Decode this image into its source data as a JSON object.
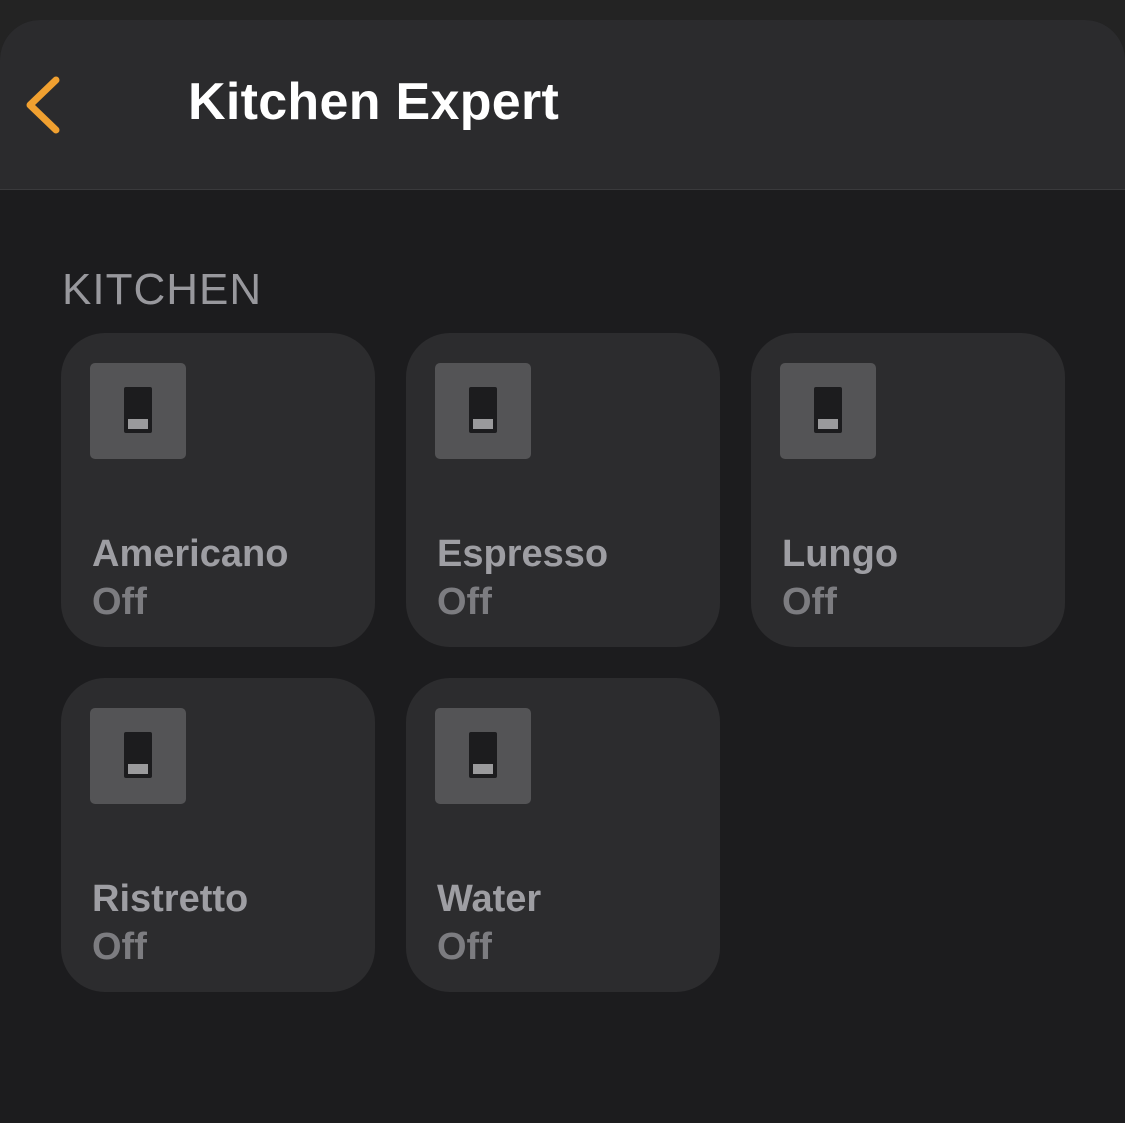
{
  "header": {
    "title": "Kitchen Expert",
    "back_icon": "chevron-left-icon",
    "accent_color": "#f0a030"
  },
  "section": {
    "label": "KITCHEN"
  },
  "tiles": [
    {
      "name": "Americano",
      "state": "Off",
      "icon": "switch-icon"
    },
    {
      "name": "Espresso",
      "state": "Off",
      "icon": "switch-icon"
    },
    {
      "name": "Lungo",
      "state": "Off",
      "icon": "switch-icon"
    },
    {
      "name": "Ristretto",
      "state": "Off",
      "icon": "switch-icon"
    },
    {
      "name": "Water",
      "state": "Off",
      "icon": "switch-icon"
    }
  ]
}
